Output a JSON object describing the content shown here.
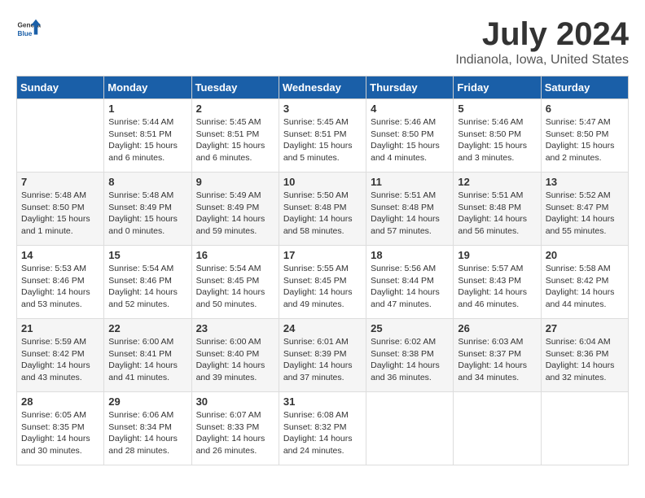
{
  "header": {
    "logo_general": "General",
    "logo_blue": "Blue",
    "title": "July 2024",
    "subtitle": "Indianola, Iowa, United States"
  },
  "days_of_week": [
    "Sunday",
    "Monday",
    "Tuesday",
    "Wednesday",
    "Thursday",
    "Friday",
    "Saturday"
  ],
  "weeks": [
    [
      {
        "day": "",
        "info": ""
      },
      {
        "day": "1",
        "info": "Sunrise: 5:44 AM\nSunset: 8:51 PM\nDaylight: 15 hours\nand 6 minutes."
      },
      {
        "day": "2",
        "info": "Sunrise: 5:45 AM\nSunset: 8:51 PM\nDaylight: 15 hours\nand 6 minutes."
      },
      {
        "day": "3",
        "info": "Sunrise: 5:45 AM\nSunset: 8:51 PM\nDaylight: 15 hours\nand 5 minutes."
      },
      {
        "day": "4",
        "info": "Sunrise: 5:46 AM\nSunset: 8:50 PM\nDaylight: 15 hours\nand 4 minutes."
      },
      {
        "day": "5",
        "info": "Sunrise: 5:46 AM\nSunset: 8:50 PM\nDaylight: 15 hours\nand 3 minutes."
      },
      {
        "day": "6",
        "info": "Sunrise: 5:47 AM\nSunset: 8:50 PM\nDaylight: 15 hours\nand 2 minutes."
      }
    ],
    [
      {
        "day": "7",
        "info": "Sunrise: 5:48 AM\nSunset: 8:50 PM\nDaylight: 15 hours\nand 1 minute."
      },
      {
        "day": "8",
        "info": "Sunrise: 5:48 AM\nSunset: 8:49 PM\nDaylight: 15 hours\nand 0 minutes."
      },
      {
        "day": "9",
        "info": "Sunrise: 5:49 AM\nSunset: 8:49 PM\nDaylight: 14 hours\nand 59 minutes."
      },
      {
        "day": "10",
        "info": "Sunrise: 5:50 AM\nSunset: 8:48 PM\nDaylight: 14 hours\nand 58 minutes."
      },
      {
        "day": "11",
        "info": "Sunrise: 5:51 AM\nSunset: 8:48 PM\nDaylight: 14 hours\nand 57 minutes."
      },
      {
        "day": "12",
        "info": "Sunrise: 5:51 AM\nSunset: 8:48 PM\nDaylight: 14 hours\nand 56 minutes."
      },
      {
        "day": "13",
        "info": "Sunrise: 5:52 AM\nSunset: 8:47 PM\nDaylight: 14 hours\nand 55 minutes."
      }
    ],
    [
      {
        "day": "14",
        "info": "Sunrise: 5:53 AM\nSunset: 8:46 PM\nDaylight: 14 hours\nand 53 minutes."
      },
      {
        "day": "15",
        "info": "Sunrise: 5:54 AM\nSunset: 8:46 PM\nDaylight: 14 hours\nand 52 minutes."
      },
      {
        "day": "16",
        "info": "Sunrise: 5:54 AM\nSunset: 8:45 PM\nDaylight: 14 hours\nand 50 minutes."
      },
      {
        "day": "17",
        "info": "Sunrise: 5:55 AM\nSunset: 8:45 PM\nDaylight: 14 hours\nand 49 minutes."
      },
      {
        "day": "18",
        "info": "Sunrise: 5:56 AM\nSunset: 8:44 PM\nDaylight: 14 hours\nand 47 minutes."
      },
      {
        "day": "19",
        "info": "Sunrise: 5:57 AM\nSunset: 8:43 PM\nDaylight: 14 hours\nand 46 minutes."
      },
      {
        "day": "20",
        "info": "Sunrise: 5:58 AM\nSunset: 8:42 PM\nDaylight: 14 hours\nand 44 minutes."
      }
    ],
    [
      {
        "day": "21",
        "info": "Sunrise: 5:59 AM\nSunset: 8:42 PM\nDaylight: 14 hours\nand 43 minutes."
      },
      {
        "day": "22",
        "info": "Sunrise: 6:00 AM\nSunset: 8:41 PM\nDaylight: 14 hours\nand 41 minutes."
      },
      {
        "day": "23",
        "info": "Sunrise: 6:00 AM\nSunset: 8:40 PM\nDaylight: 14 hours\nand 39 minutes."
      },
      {
        "day": "24",
        "info": "Sunrise: 6:01 AM\nSunset: 8:39 PM\nDaylight: 14 hours\nand 37 minutes."
      },
      {
        "day": "25",
        "info": "Sunrise: 6:02 AM\nSunset: 8:38 PM\nDaylight: 14 hours\nand 36 minutes."
      },
      {
        "day": "26",
        "info": "Sunrise: 6:03 AM\nSunset: 8:37 PM\nDaylight: 14 hours\nand 34 minutes."
      },
      {
        "day": "27",
        "info": "Sunrise: 6:04 AM\nSunset: 8:36 PM\nDaylight: 14 hours\nand 32 minutes."
      }
    ],
    [
      {
        "day": "28",
        "info": "Sunrise: 6:05 AM\nSunset: 8:35 PM\nDaylight: 14 hours\nand 30 minutes."
      },
      {
        "day": "29",
        "info": "Sunrise: 6:06 AM\nSunset: 8:34 PM\nDaylight: 14 hours\nand 28 minutes."
      },
      {
        "day": "30",
        "info": "Sunrise: 6:07 AM\nSunset: 8:33 PM\nDaylight: 14 hours\nand 26 minutes."
      },
      {
        "day": "31",
        "info": "Sunrise: 6:08 AM\nSunset: 8:32 PM\nDaylight: 14 hours\nand 24 minutes."
      },
      {
        "day": "",
        "info": ""
      },
      {
        "day": "",
        "info": ""
      },
      {
        "day": "",
        "info": ""
      }
    ]
  ]
}
